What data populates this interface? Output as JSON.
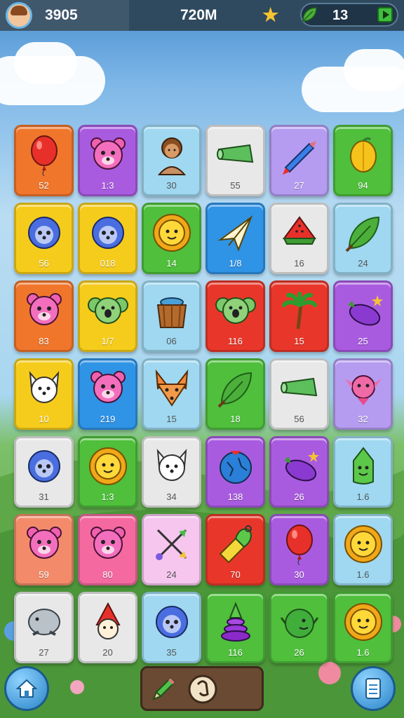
{
  "topbar": {
    "coins": "3905",
    "center_value": "720M",
    "leaf_count": "13"
  },
  "colors": {
    "orange": "#f0762b",
    "purple": "#a95be0",
    "lightblue": "#9fd8f0",
    "white": "#e8e8e8",
    "lavender": "#b59cf0",
    "green": "#4fbf3c",
    "yellow": "#f6cc1c",
    "blue": "#2f93e6",
    "red": "#e8372a",
    "pink": "#f46aa0",
    "salmon": "#f38b6b",
    "lightpink": "#f6c6ef"
  },
  "tiles": [
    {
      "num": "52",
      "color": "orange",
      "icon": "balloon-icon"
    },
    {
      "num": "1:3",
      "color": "purple",
      "icon": "bear-icon"
    },
    {
      "num": "30",
      "color": "lightblue",
      "icon": "person-icon"
    },
    {
      "num": "55",
      "color": "white",
      "icon": "pipe-icon"
    },
    {
      "num": "27",
      "color": "lavender",
      "icon": "crayon-icon"
    },
    {
      "num": "94",
      "color": "green",
      "icon": "lemon-icon"
    },
    {
      "num": "56",
      "color": "yellow",
      "icon": "hedgehog-icon"
    },
    {
      "num": "018",
      "color": "yellow",
      "icon": "hedgehog-icon"
    },
    {
      "num": "14",
      "color": "green",
      "icon": "sun-icon"
    },
    {
      "num": "1/8",
      "color": "blue",
      "icon": "paper-plane-icon"
    },
    {
      "num": "16",
      "color": "white",
      "icon": "watermelon-icon"
    },
    {
      "num": "24",
      "color": "lightblue",
      "icon": "leaf-icon"
    },
    {
      "num": "83",
      "color": "orange",
      "icon": "bear-icon"
    },
    {
      "num": "1/7",
      "color": "yellow",
      "icon": "koala-icon"
    },
    {
      "num": "06",
      "color": "lightblue",
      "icon": "basket-icon"
    },
    {
      "num": "116",
      "color": "red",
      "icon": "koala-icon"
    },
    {
      "num": "15",
      "color": "red",
      "icon": "palm-tree-icon"
    },
    {
      "num": "25",
      "color": "purple",
      "icon": "eggplant-icon"
    },
    {
      "num": "10",
      "color": "yellow",
      "icon": "dog-icon"
    },
    {
      "num": "219",
      "color": "blue",
      "icon": "bear-icon"
    },
    {
      "num": "15",
      "color": "lightblue",
      "icon": "fox-icon"
    },
    {
      "num": "18",
      "color": "green",
      "icon": "leaf-icon"
    },
    {
      "num": "56",
      "color": "white",
      "icon": "pipe-icon"
    },
    {
      "num": "32",
      "color": "lavender",
      "icon": "creature-icon"
    },
    {
      "num": "31",
      "color": "white",
      "icon": "hedgehog-icon"
    },
    {
      "num": "1:3",
      "color": "green",
      "icon": "sun-icon"
    },
    {
      "num": "34",
      "color": "white",
      "icon": "dog-icon"
    },
    {
      "num": "138",
      "color": "purple",
      "icon": "globe-icon"
    },
    {
      "num": "26",
      "color": "purple",
      "icon": "eggplant-icon"
    },
    {
      "num": "1.6",
      "color": "lightblue",
      "icon": "pepper-icon"
    },
    {
      "num": "59",
      "color": "salmon",
      "icon": "bear-icon"
    },
    {
      "num": "80",
      "color": "pink",
      "icon": "bear-icon"
    },
    {
      "num": "24",
      "color": "lightpink",
      "icon": "arrows-icon"
    },
    {
      "num": "70",
      "color": "red",
      "icon": "whistle-icon"
    },
    {
      "num": "30",
      "color": "purple",
      "icon": "balloon-icon"
    },
    {
      "num": "1.6",
      "color": "lightblue",
      "icon": "sun-icon"
    },
    {
      "num": "27",
      "color": "white",
      "icon": "seal-icon"
    },
    {
      "num": "20",
      "color": "white",
      "icon": "cat-icon"
    },
    {
      "num": "35",
      "color": "lightblue",
      "icon": "hedgehog-icon"
    },
    {
      "num": "116",
      "color": "green",
      "icon": "ring-stack-icon"
    },
    {
      "num": "26",
      "color": "green",
      "icon": "turtle-icon"
    },
    {
      "num": "1.6",
      "color": "green",
      "icon": "sun-icon"
    }
  ]
}
